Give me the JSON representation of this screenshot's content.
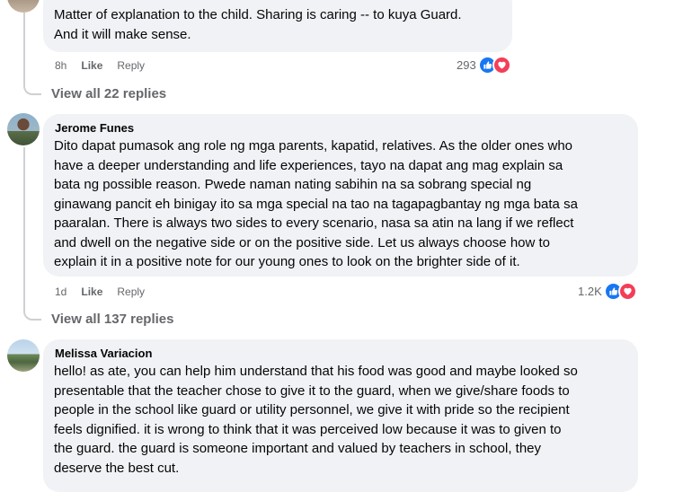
{
  "comment1": {
    "text": "Matter of explanation to the child. Sharing is caring -- to kuya Guard.\nAnd it will make sense.",
    "time": "8h",
    "like_label": "Like",
    "reply_label": "Reply",
    "reaction_count": "293"
  },
  "thread1": {
    "view_replies": "View all 22 replies"
  },
  "comment2": {
    "author": "Jerome Funes",
    "lines": [
      "Dito dapat pumasok ang role ng mga parents, kapatid, relatives. As the older ones who",
      "have a deeper understanding and life experiences, tayo na dapat ang mag explain sa",
      "bata ng possible reason. Pwede naman nating sabihin na sa sobrang special ng",
      "ginawang pancit eh binigay ito sa mga special na tao na tagapagbantay ng mga bata sa",
      "paaralan. There is always two sides to every scenario, nasa sa atin na lang if we reflect",
      "and dwell on the negative side or on the positive side. Let us always choose how to",
      "explain it in a positive note for our young ones to look on the brighter side of it."
    ],
    "time": "1d",
    "like_label": "Like",
    "reply_label": "Reply",
    "reaction_count": "1.2K"
  },
  "thread2": {
    "view_replies": "View all 137 replies"
  },
  "comment3": {
    "author": "Melissa Variacion",
    "lines": [
      "hello! as ate, you can help him understand that his food was good and maybe looked so",
      "presentable that the teacher chose to give it to the guard, when we give/share foods to",
      "people in the school like guard or utility personnel, we give it with pride so the recipient",
      "feels dignified. it is wrong to think that it was perceived low because it was to given to",
      "the guard. the guard is someone important and valued by teachers in school, they",
      "deserve the best cut."
    ]
  },
  "icons": {
    "like": "like-reaction-icon",
    "love": "love-reaction-icon"
  },
  "colors": {
    "like": "#1877f2",
    "love": "#f33e58",
    "bubble": "#f0f2f5",
    "meta": "#65676b"
  }
}
